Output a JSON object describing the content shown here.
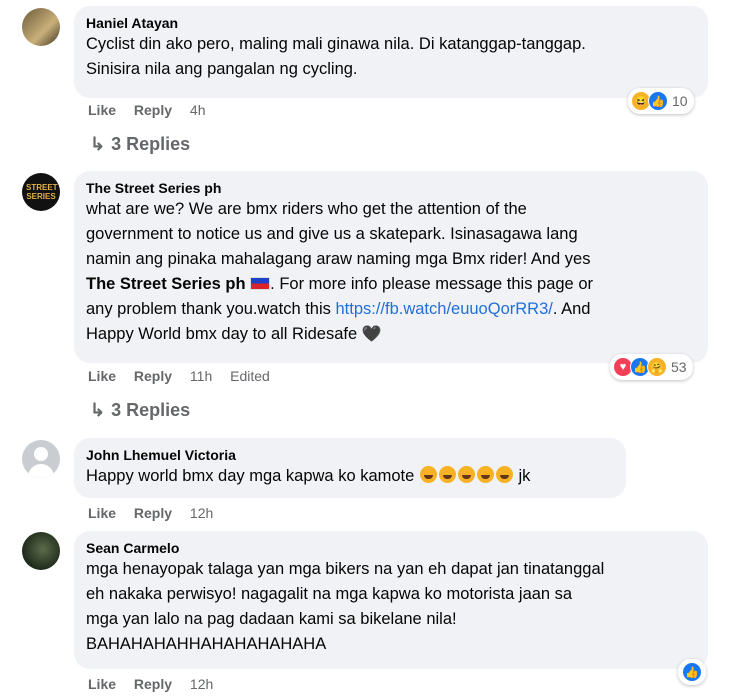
{
  "comments": [
    {
      "author": "Haniel Atayan",
      "lines": [
        "Cyclist din ako pero, maling mali ginawa nila. Di katanggap-tanggap.",
        "Sinisira nila ang pangalan ng cycling."
      ],
      "like": "Like",
      "reply": "Reply",
      "time": "4h",
      "reaction_count": "10",
      "reactions": [
        "haha",
        "like"
      ],
      "replies": "3 Replies"
    },
    {
      "author": "The Street Series ph",
      "avatar_text": "STREET SERIES",
      "line1": "what are we? We are bmx riders who get the attention of the",
      "line2": "government to notice us and give us a skatepark. Isinasagawa lang",
      "line3": "namin ang pinaka mahalagang araw naming mga Bmx rider! And yes",
      "line4_bold": "The Street Series ph",
      "line4_rest": ". For more info please message this page or",
      "line5_pre": "any problem thank you.watch this ",
      "line5_link": "https://fb.watch/euuoQorRR3/",
      "line5_post": ". And",
      "line6": "Happy World bmx day to all Ridesafe",
      "like": "Like",
      "reply": "Reply",
      "time": "11h",
      "edited": "Edited",
      "reaction_count": "53",
      "reactions": [
        "love",
        "like",
        "care"
      ],
      "replies": "3 Replies"
    },
    {
      "author": "John Lhemuel Victoria",
      "text": "Happy world bmx day mga kapwa ko kamote",
      "text_end": "jk",
      "like": "Like",
      "reply": "Reply",
      "time": "12h"
    },
    {
      "author": "Sean Carmelo",
      "lines": [
        "mga henayopak talaga yan mga bikers na yan eh dapat jan tinatanggal",
        "eh nakaka perwisyo! nagagalit na mga kapwa ko motorista jaan sa",
        "mga yan lalo na pag dadaan kami sa bikelane nila!",
        "BAHAHAHAHHAHAHAHAHAHA"
      ],
      "like": "Like",
      "reply": "Reply",
      "time": "12h",
      "reactions": [
        "like"
      ]
    }
  ],
  "colors": {
    "bubble": "#f0f2f5",
    "meta": "#65676b",
    "link": "#216fdb",
    "like_blue": "#1877f2"
  }
}
